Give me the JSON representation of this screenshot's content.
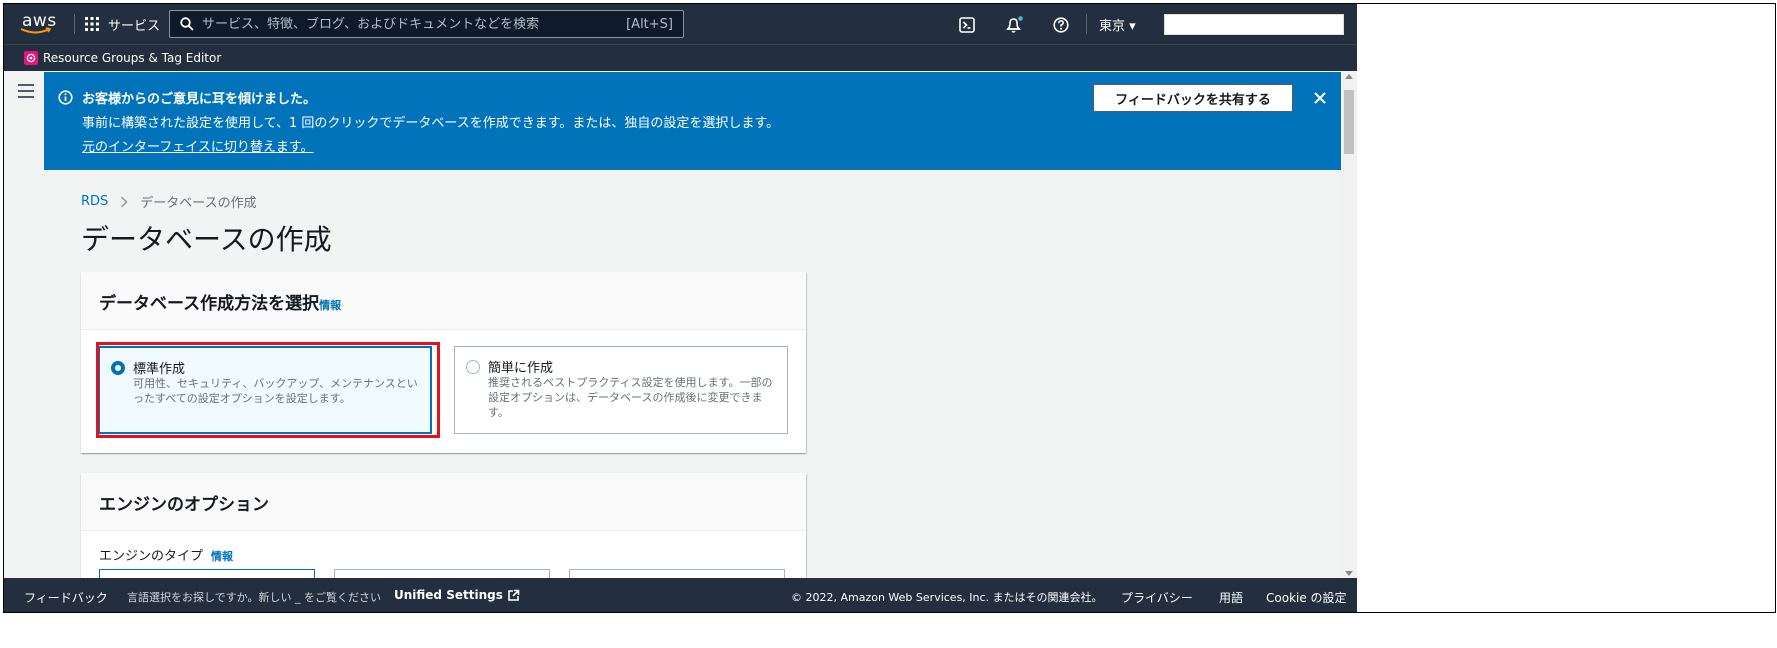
{
  "nav": {
    "logo_text": "aws",
    "services_label": "サービス",
    "search_placeholder": "サービス、特徴、ブログ、およびドキュメントなどを検索",
    "search_shortcut": "[Alt+S]",
    "region": "東京 ▾"
  },
  "favorites": {
    "items": [
      {
        "label": "Resource Groups & Tag Editor"
      }
    ]
  },
  "flash": {
    "title": "お客様からのご意見に耳を傾けました。",
    "body": "事前に構築された設定を使用して、1 回のクリックでデータベースを作成できます。または、独自の設定を選択します。",
    "switch_link": "元のインターフェイスに切り替えます。",
    "feedback_button": "フィードバックを共有する"
  },
  "breadcrumb": {
    "root": "RDS",
    "current": "データベースの作成"
  },
  "page_title": "データベースの作成",
  "method_panel": {
    "title": "データベース作成方法を選択",
    "info": "情報",
    "options": [
      {
        "name": "標準作成",
        "description": "可用性、セキュリティ、バックアップ、メンテナンスといったすべての設定オプションを設定します。",
        "selected": true
      },
      {
        "name": "簡単に作成",
        "description": "推奨されるベストプラクティス設定を使用します。一部の設定オプションは、データベースの作成後に変更できます。",
        "selected": false
      }
    ]
  },
  "engine_panel": {
    "title": "エンジンのオプション",
    "type_label": "エンジンのタイプ",
    "info": "情報"
  },
  "footer": {
    "feedback": "フィードバック",
    "language_prompt": "言語選択をお探しですか。新しい _ をご覧ください",
    "unified_settings": "Unified Settings",
    "copyright": "© 2022, Amazon Web Services, Inc. またはその関連会社。",
    "privacy": "プライバシー",
    "terms": "用語",
    "cookie": "Cookie の設定"
  },
  "colors": {
    "nav_bg": "#232f3e",
    "flash_bg": "#0073bb",
    "accent": "#0073bb",
    "highlight": "#e0141e"
  }
}
